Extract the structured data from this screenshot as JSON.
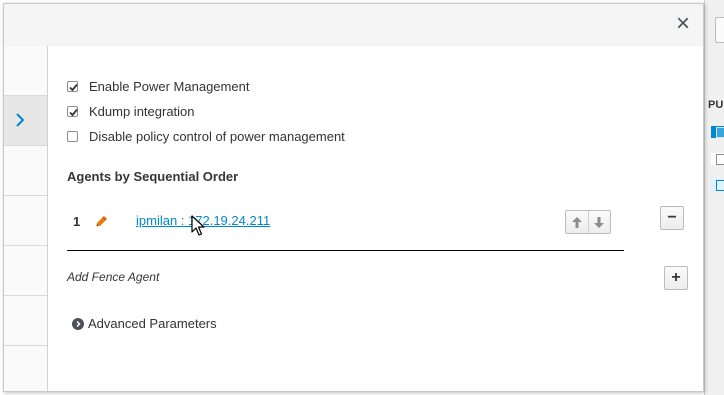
{
  "background": {
    "column_text": "PU"
  },
  "dialog": {
    "close_label": "×",
    "checkboxes": [
      {
        "label": "Enable Power Management",
        "checked": true
      },
      {
        "label": "Kdump integration",
        "checked": true
      },
      {
        "label": "Disable policy control of power management",
        "checked": false
      }
    ],
    "agents_title": "Agents by Sequential Order",
    "agents": [
      {
        "order": "1",
        "label": "ipmilan : 172.19.24.211"
      }
    ],
    "remove_label": "−",
    "add_agent_label": "Add Fence Agent",
    "add_label": "+",
    "advanced_label": "Advanced Parameters"
  },
  "colors": {
    "link": "#0088ce",
    "pencil": "#ec7a08",
    "header_bg": "#f5f5f5"
  },
  "icons": [
    "close-icon",
    "chevron-right-icon",
    "check-icon",
    "pencil-icon",
    "arrow-up-icon",
    "arrow-down-icon",
    "minus-icon",
    "plus-icon",
    "expand-circle-icon",
    "mouse-cursor-icon"
  ]
}
